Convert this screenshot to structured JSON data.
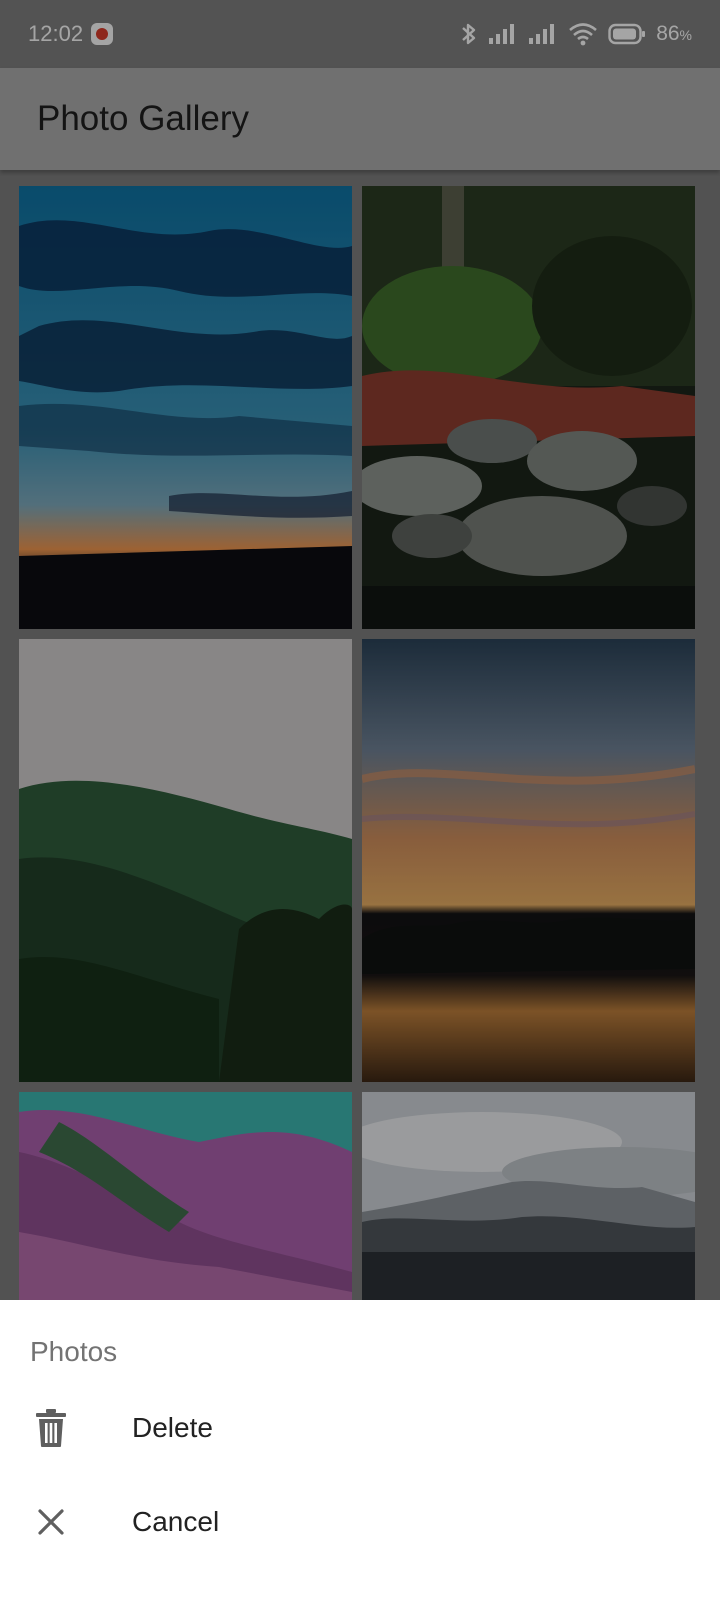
{
  "status_bar": {
    "time": "12:02",
    "battery_percent": "86",
    "battery_suffix": "%",
    "icons": [
      "app-notification-icon",
      "bluetooth-icon",
      "signal-icon",
      "signal-icon",
      "wifi-icon",
      "battery-icon"
    ]
  },
  "app_bar": {
    "title": "Photo Gallery"
  },
  "gallery": {
    "photos": [
      {
        "subject": "blue dusk sky with clouds over grass silhouette"
      },
      {
        "subject": "forest stream with rocks and ferns"
      },
      {
        "subject": "green forested hillside under pale sky"
      },
      {
        "subject": "sunset over lake with tree line reflection"
      },
      {
        "subject": "pink flowering mountain slopes with turquoise sky"
      },
      {
        "subject": "distant mountain range under cloudy sky"
      }
    ]
  },
  "sheet": {
    "title": "Photos",
    "items": [
      {
        "label": "Delete",
        "icon": "trash-icon"
      },
      {
        "label": "Cancel",
        "icon": "close-icon"
      }
    ]
  },
  "colors": {
    "status_bar": "#7b7b7b",
    "app_bar": "#a6a6a6",
    "scrim": "rgba(0,0,0,0.32)",
    "sheet": "#ffffff"
  }
}
